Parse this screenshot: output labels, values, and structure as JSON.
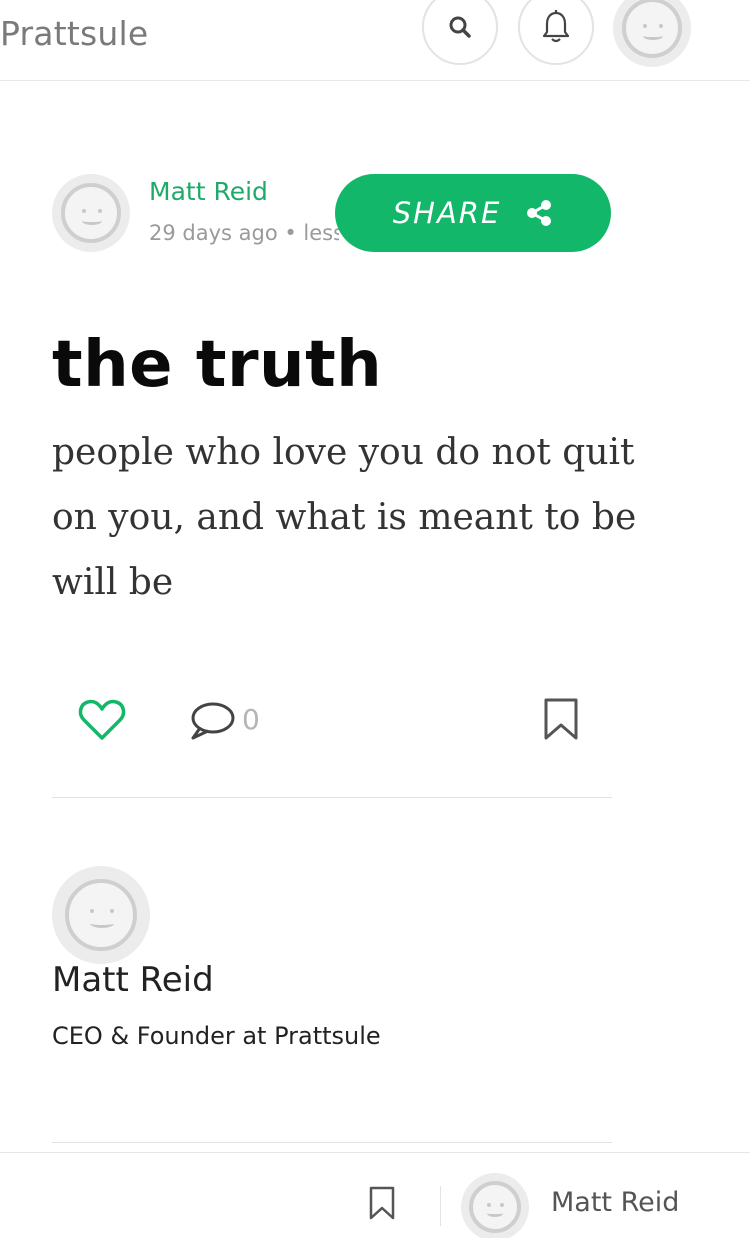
{
  "header": {
    "brand": "Prattsule",
    "icons": {
      "search": "search-icon",
      "notifications": "bell-icon",
      "avatar": "avatar-icon"
    }
  },
  "post": {
    "author": {
      "name": "Matt Reid",
      "meta": "29 days ago • less"
    },
    "share_label": "SHARE",
    "title": "the truth",
    "body": "people who love you do not quit on you, and what is meant to be will be",
    "comment_count": "0"
  },
  "author_card": {
    "name": "Matt Reid",
    "role": "CEO & Founder at Prattsule"
  },
  "bottom_bar": {
    "author_name": "Matt Reid"
  },
  "colors": {
    "accent": "#12b76a",
    "author_link": "#1faa6a",
    "muted": "#9a9a9a"
  }
}
